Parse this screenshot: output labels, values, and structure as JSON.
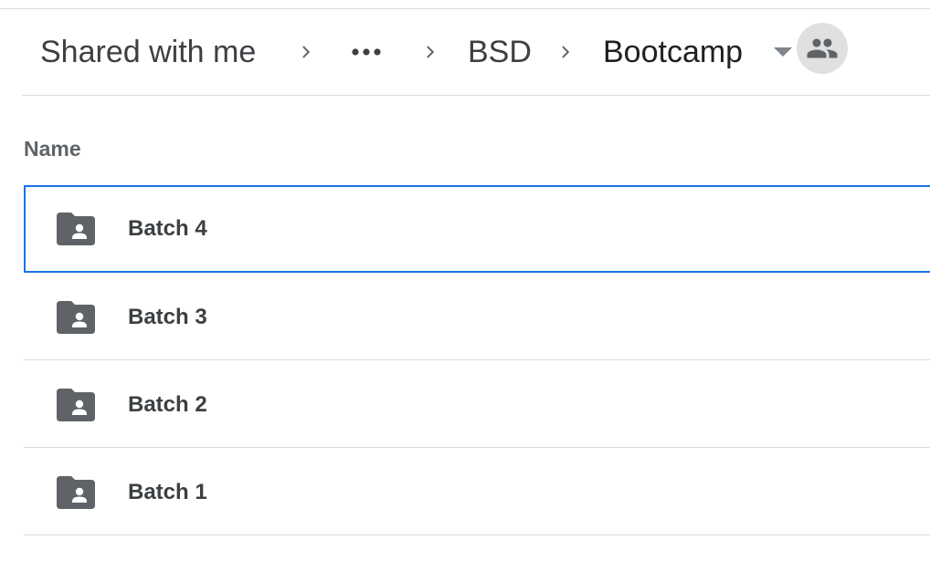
{
  "breadcrumb": {
    "items": [
      {
        "label": "Shared with me"
      },
      {
        "label": "•••"
      },
      {
        "label": "BSD"
      },
      {
        "label": "Bootcamp"
      }
    ],
    "separator_icon": "chevron-right-icon",
    "dropdown_icon": "caret-down-icon",
    "shared_icon": "people-icon"
  },
  "list": {
    "column_header": "Name",
    "rows": [
      {
        "name": "Batch 4",
        "icon": "shared-folder-icon",
        "selected": true
      },
      {
        "name": "Batch 3",
        "icon": "shared-folder-icon",
        "selected": false
      },
      {
        "name": "Batch 2",
        "icon": "shared-folder-icon",
        "selected": false
      },
      {
        "name": "Batch 1",
        "icon": "shared-folder-icon",
        "selected": false
      }
    ]
  },
  "colors": {
    "text_primary": "#202124",
    "text_secondary": "#5f6368",
    "icon": "#5f6368",
    "divider": "#dadce0",
    "selection": "#1a73e8",
    "avatar_bg": "#e0e0e0"
  }
}
